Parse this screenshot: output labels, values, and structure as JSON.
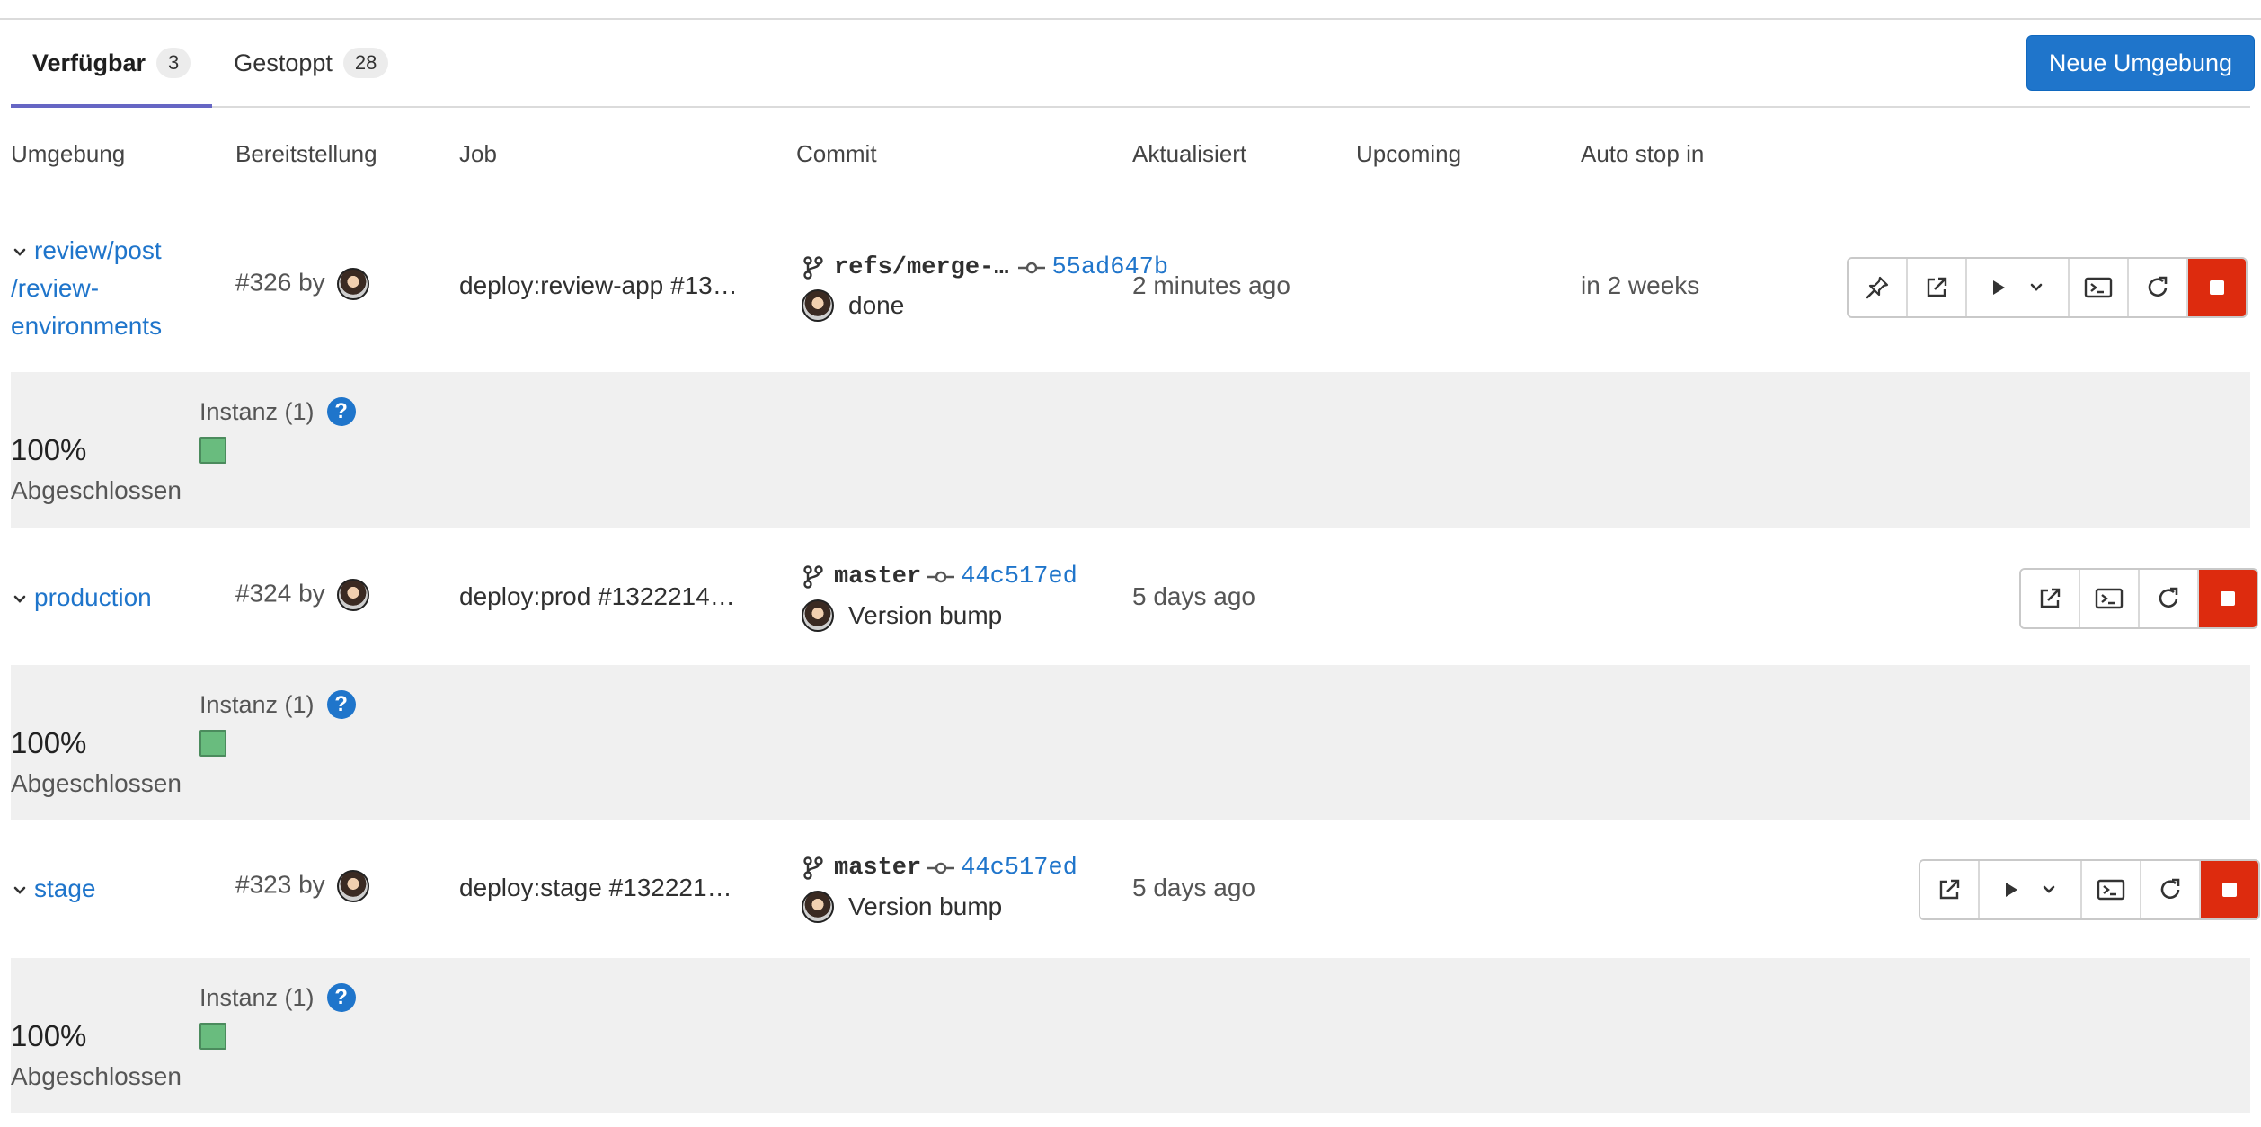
{
  "tabs": [
    {
      "label": "Verfügbar",
      "count": "3"
    },
    {
      "label": "Gestoppt",
      "count": "28"
    }
  ],
  "new_env_button": "Neue Umgebung",
  "columns": {
    "environment": "Umgebung",
    "deployment": "Bereitstellung",
    "job": "Job",
    "commit": "Commit",
    "updated": "Aktualisiert",
    "upcoming": "Upcoming",
    "auto_stop": "Auto stop in"
  },
  "environments": [
    {
      "name_line1": "review/post",
      "name_line2": "/review-",
      "name_line3": "environments",
      "deployment": "#326 by",
      "job": "deploy:review-app #13…",
      "ref": "refs/merge-…",
      "sha": "55ad647b",
      "message": "done",
      "updated": "2 minutes ago",
      "auto_stop": "in 2 weeks",
      "instances_label": "Instanz (1)",
      "percent": "100%",
      "status": "Abgeschlossen"
    },
    {
      "name": "production",
      "deployment": "#324 by",
      "job": "deploy:prod #1322214…",
      "ref": "master",
      "sha": "44c517ed",
      "message": "Version bump",
      "updated": "5 days ago",
      "instances_label": "Instanz (1)",
      "percent": "100%",
      "status": "Abgeschlossen"
    },
    {
      "name": "stage",
      "deployment": "#323 by",
      "job": "deploy:stage #132221…",
      "ref": "master",
      "sha": "44c517ed",
      "message": "Version bump",
      "updated": "5 days ago",
      "instances_label": "Instanz (1)",
      "percent": "100%",
      "status": "Abgeschlossen"
    }
  ],
  "help_glyph": "?",
  "colors": {
    "primary": "#1f75cb",
    "danger": "#dd2b0e",
    "instance_ok": "#52b36b",
    "tab_active": "#6666c4"
  }
}
